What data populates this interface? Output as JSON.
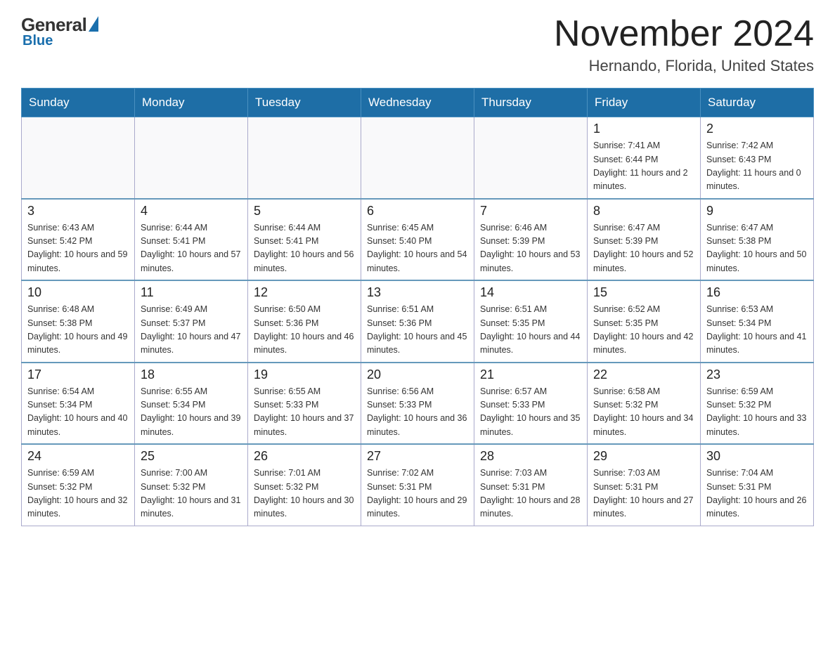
{
  "logo": {
    "general": "General",
    "blue": "Blue",
    "subtitle": "Blue"
  },
  "header": {
    "title": "November 2024",
    "location": "Hernando, Florida, United States"
  },
  "weekdays": [
    "Sunday",
    "Monday",
    "Tuesday",
    "Wednesday",
    "Thursday",
    "Friday",
    "Saturday"
  ],
  "weeks": [
    [
      {
        "day": "",
        "sunrise": "",
        "sunset": "",
        "daylight": ""
      },
      {
        "day": "",
        "sunrise": "",
        "sunset": "",
        "daylight": ""
      },
      {
        "day": "",
        "sunrise": "",
        "sunset": "",
        "daylight": ""
      },
      {
        "day": "",
        "sunrise": "",
        "sunset": "",
        "daylight": ""
      },
      {
        "day": "",
        "sunrise": "",
        "sunset": "",
        "daylight": ""
      },
      {
        "day": "1",
        "sunrise": "Sunrise: 7:41 AM",
        "sunset": "Sunset: 6:44 PM",
        "daylight": "Daylight: 11 hours and 2 minutes."
      },
      {
        "day": "2",
        "sunrise": "Sunrise: 7:42 AM",
        "sunset": "Sunset: 6:43 PM",
        "daylight": "Daylight: 11 hours and 0 minutes."
      }
    ],
    [
      {
        "day": "3",
        "sunrise": "Sunrise: 6:43 AM",
        "sunset": "Sunset: 5:42 PM",
        "daylight": "Daylight: 10 hours and 59 minutes."
      },
      {
        "day": "4",
        "sunrise": "Sunrise: 6:44 AM",
        "sunset": "Sunset: 5:41 PM",
        "daylight": "Daylight: 10 hours and 57 minutes."
      },
      {
        "day": "5",
        "sunrise": "Sunrise: 6:44 AM",
        "sunset": "Sunset: 5:41 PM",
        "daylight": "Daylight: 10 hours and 56 minutes."
      },
      {
        "day": "6",
        "sunrise": "Sunrise: 6:45 AM",
        "sunset": "Sunset: 5:40 PM",
        "daylight": "Daylight: 10 hours and 54 minutes."
      },
      {
        "day": "7",
        "sunrise": "Sunrise: 6:46 AM",
        "sunset": "Sunset: 5:39 PM",
        "daylight": "Daylight: 10 hours and 53 minutes."
      },
      {
        "day": "8",
        "sunrise": "Sunrise: 6:47 AM",
        "sunset": "Sunset: 5:39 PM",
        "daylight": "Daylight: 10 hours and 52 minutes."
      },
      {
        "day": "9",
        "sunrise": "Sunrise: 6:47 AM",
        "sunset": "Sunset: 5:38 PM",
        "daylight": "Daylight: 10 hours and 50 minutes."
      }
    ],
    [
      {
        "day": "10",
        "sunrise": "Sunrise: 6:48 AM",
        "sunset": "Sunset: 5:38 PM",
        "daylight": "Daylight: 10 hours and 49 minutes."
      },
      {
        "day": "11",
        "sunrise": "Sunrise: 6:49 AM",
        "sunset": "Sunset: 5:37 PM",
        "daylight": "Daylight: 10 hours and 47 minutes."
      },
      {
        "day": "12",
        "sunrise": "Sunrise: 6:50 AM",
        "sunset": "Sunset: 5:36 PM",
        "daylight": "Daylight: 10 hours and 46 minutes."
      },
      {
        "day": "13",
        "sunrise": "Sunrise: 6:51 AM",
        "sunset": "Sunset: 5:36 PM",
        "daylight": "Daylight: 10 hours and 45 minutes."
      },
      {
        "day": "14",
        "sunrise": "Sunrise: 6:51 AM",
        "sunset": "Sunset: 5:35 PM",
        "daylight": "Daylight: 10 hours and 44 minutes."
      },
      {
        "day": "15",
        "sunrise": "Sunrise: 6:52 AM",
        "sunset": "Sunset: 5:35 PM",
        "daylight": "Daylight: 10 hours and 42 minutes."
      },
      {
        "day": "16",
        "sunrise": "Sunrise: 6:53 AM",
        "sunset": "Sunset: 5:34 PM",
        "daylight": "Daylight: 10 hours and 41 minutes."
      }
    ],
    [
      {
        "day": "17",
        "sunrise": "Sunrise: 6:54 AM",
        "sunset": "Sunset: 5:34 PM",
        "daylight": "Daylight: 10 hours and 40 minutes."
      },
      {
        "day": "18",
        "sunrise": "Sunrise: 6:55 AM",
        "sunset": "Sunset: 5:34 PM",
        "daylight": "Daylight: 10 hours and 39 minutes."
      },
      {
        "day": "19",
        "sunrise": "Sunrise: 6:55 AM",
        "sunset": "Sunset: 5:33 PM",
        "daylight": "Daylight: 10 hours and 37 minutes."
      },
      {
        "day": "20",
        "sunrise": "Sunrise: 6:56 AM",
        "sunset": "Sunset: 5:33 PM",
        "daylight": "Daylight: 10 hours and 36 minutes."
      },
      {
        "day": "21",
        "sunrise": "Sunrise: 6:57 AM",
        "sunset": "Sunset: 5:33 PM",
        "daylight": "Daylight: 10 hours and 35 minutes."
      },
      {
        "day": "22",
        "sunrise": "Sunrise: 6:58 AM",
        "sunset": "Sunset: 5:32 PM",
        "daylight": "Daylight: 10 hours and 34 minutes."
      },
      {
        "day": "23",
        "sunrise": "Sunrise: 6:59 AM",
        "sunset": "Sunset: 5:32 PM",
        "daylight": "Daylight: 10 hours and 33 minutes."
      }
    ],
    [
      {
        "day": "24",
        "sunrise": "Sunrise: 6:59 AM",
        "sunset": "Sunset: 5:32 PM",
        "daylight": "Daylight: 10 hours and 32 minutes."
      },
      {
        "day": "25",
        "sunrise": "Sunrise: 7:00 AM",
        "sunset": "Sunset: 5:32 PM",
        "daylight": "Daylight: 10 hours and 31 minutes."
      },
      {
        "day": "26",
        "sunrise": "Sunrise: 7:01 AM",
        "sunset": "Sunset: 5:32 PM",
        "daylight": "Daylight: 10 hours and 30 minutes."
      },
      {
        "day": "27",
        "sunrise": "Sunrise: 7:02 AM",
        "sunset": "Sunset: 5:31 PM",
        "daylight": "Daylight: 10 hours and 29 minutes."
      },
      {
        "day": "28",
        "sunrise": "Sunrise: 7:03 AM",
        "sunset": "Sunset: 5:31 PM",
        "daylight": "Daylight: 10 hours and 28 minutes."
      },
      {
        "day": "29",
        "sunrise": "Sunrise: 7:03 AM",
        "sunset": "Sunset: 5:31 PM",
        "daylight": "Daylight: 10 hours and 27 minutes."
      },
      {
        "day": "30",
        "sunrise": "Sunrise: 7:04 AM",
        "sunset": "Sunset: 5:31 PM",
        "daylight": "Daylight: 10 hours and 26 minutes."
      }
    ]
  ]
}
